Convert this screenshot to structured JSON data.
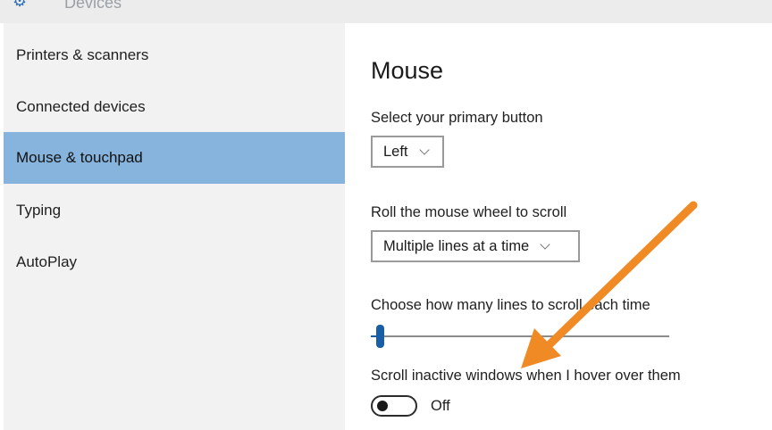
{
  "window": {
    "title": "Devices",
    "title_icon": "gear-icon"
  },
  "sidebar": {
    "items": [
      {
        "label": "Printers & scanners",
        "active": false
      },
      {
        "label": "Connected devices",
        "active": false
      },
      {
        "label": "Mouse & touchpad",
        "active": true
      },
      {
        "label": "Typing",
        "active": false
      },
      {
        "label": "AutoPlay",
        "active": false
      }
    ]
  },
  "main": {
    "title": "Mouse",
    "primary_button": {
      "label": "Select your primary button",
      "value": "Left"
    },
    "wheel_scroll": {
      "label": "Roll the mouse wheel to scroll",
      "value": "Multiple lines at a time"
    },
    "lines_to_scroll": {
      "label": "Choose how many lines to scroll each time",
      "slider_fraction": 0.03
    },
    "scroll_inactive": {
      "label": "Scroll inactive windows when I hover over them",
      "state": "Off"
    }
  },
  "colors": {
    "sidebar_bg": "#f2f2f2",
    "active_item": "#86b4dc",
    "accent": "#1a5ea8",
    "annotation_arrow": "#f08a24"
  }
}
